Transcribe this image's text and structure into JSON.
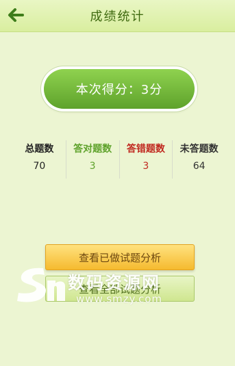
{
  "header": {
    "title": "成绩统计",
    "back_icon": "back-arrow-icon"
  },
  "score": {
    "text": "本次得分：3分"
  },
  "stats": [
    {
      "label": "总题数",
      "value": "70",
      "color": "#222222"
    },
    {
      "label": "答对题数",
      "value": "3",
      "color": "#5ea22b"
    },
    {
      "label": "答错题数",
      "value": "3",
      "color": "#c0281f"
    },
    {
      "label": "未答题数",
      "value": "64",
      "color": "#333333"
    }
  ],
  "buttons": {
    "analysis_label": "查看已做试题分析",
    "second_label": "查看全部试题分析"
  },
  "watermark": {
    "text": "数码资源网",
    "url": "www.smzy.com"
  },
  "colors": {
    "background": "#ecf5d2",
    "header": "#d9ee9f",
    "accent_green": "#5ea22b",
    "accent_orange": "#f5ba2f"
  }
}
